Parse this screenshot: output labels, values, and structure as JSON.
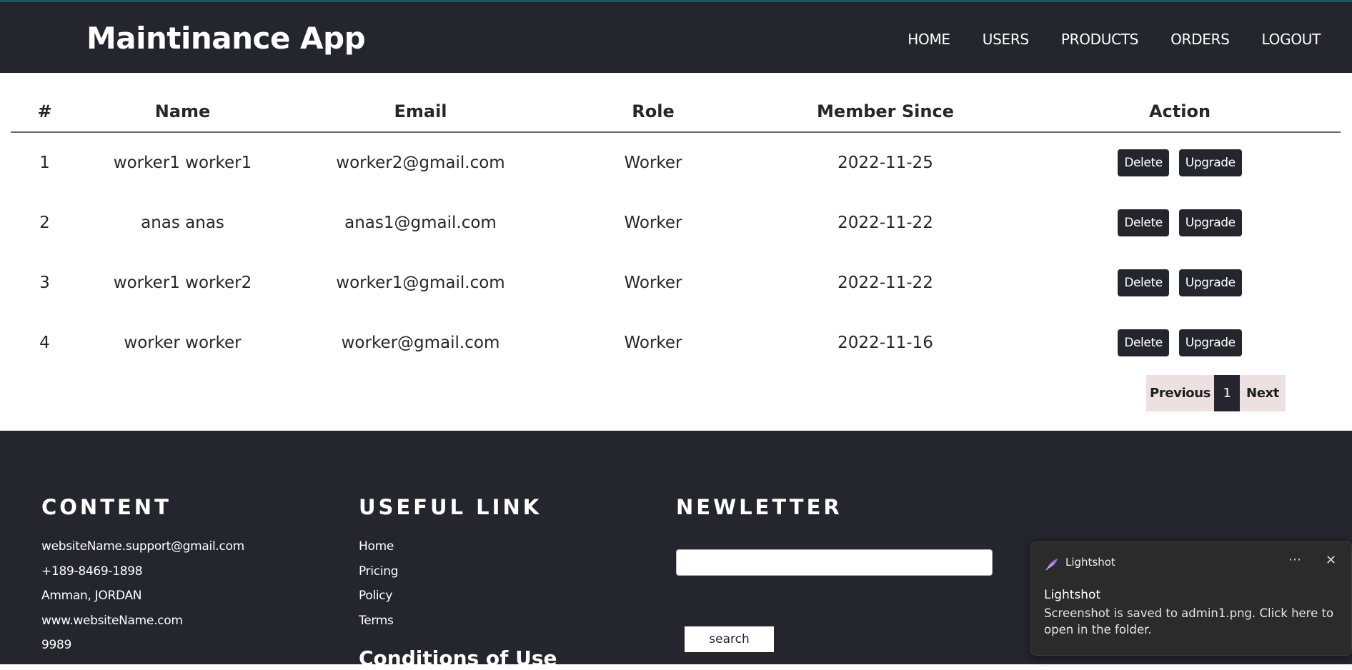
{
  "app": {
    "title": "Maintinance App"
  },
  "nav": {
    "links": [
      "HOME",
      "USERS",
      "PRODUCTS",
      "ORDERS",
      "LOGOUT"
    ]
  },
  "table": {
    "headers": [
      "#",
      "Name",
      "Email",
      "Role",
      "Member Since",
      "Action"
    ],
    "rows": [
      {
        "num": "1",
        "name": "worker1 worker1",
        "email": "worker2@gmail.com",
        "role": "Worker",
        "since": "2022-11-25"
      },
      {
        "num": "2",
        "name": "anas anas",
        "email": "anas1@gmail.com",
        "role": "Worker",
        "since": "2022-11-22"
      },
      {
        "num": "3",
        "name": "worker1 worker2",
        "email": "worker1@gmail.com",
        "role": "Worker",
        "since": "2022-11-22"
      },
      {
        "num": "4",
        "name": "worker worker",
        "email": "worker@gmail.com",
        "role": "Worker",
        "since": "2022-11-16"
      }
    ],
    "action_labels": {
      "delete": "Delete",
      "upgrade": "Upgrade"
    }
  },
  "pagination": {
    "previous": "Previous",
    "current_page": "1",
    "next": "Next"
  },
  "footer": {
    "content": {
      "heading": "CONTENT",
      "lines": [
        "websiteName.support@gmail.com",
        "+189-8469-1898",
        "Amman, JORDAN",
        "www.websiteName.com",
        "9989"
      ]
    },
    "useful_link": {
      "heading": "USEFUL LINK",
      "links": [
        "Home",
        "Pricing",
        "Policy",
        "Terms"
      ],
      "subheading": "Conditions of Use"
    },
    "newsletter": {
      "heading": "NEWLETTER",
      "input_value": "",
      "button_label": "search"
    }
  },
  "toast": {
    "app_name": "Lightshot",
    "more_icon": "more-icon",
    "close_icon": "close-icon",
    "title": "Lightshot",
    "body": "Screenshot is saved to admin1.png. Click here to open in the folder."
  },
  "colors": {
    "dark": "#25252d",
    "accent_top": "#0f5e63",
    "pagination_bg": "#ede0e0",
    "toast_bg": "#2b2b2b"
  }
}
